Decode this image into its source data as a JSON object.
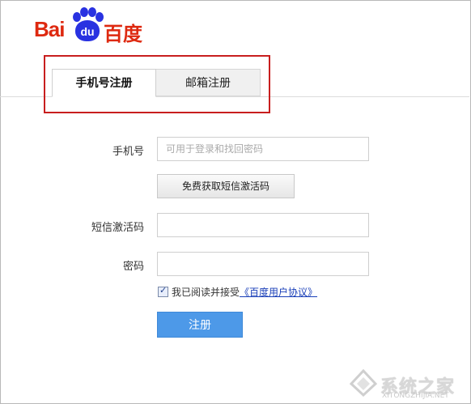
{
  "brand": {
    "logo_latin": "Bai",
    "logo_paw_text": "du",
    "logo_chinese": "百度"
  },
  "tabs": [
    {
      "label": "手机号注册",
      "active": true
    },
    {
      "label": "邮箱注册",
      "active": false
    }
  ],
  "form": {
    "phone_label": "手机号",
    "phone_placeholder": "可用于登录和找回密码",
    "sms_button": "免费获取短信激活码",
    "sms_code_label": "短信激活码",
    "password_label": "密码",
    "agree_text": "我已阅读并接受",
    "agree_link": "《百度用户协议》",
    "agree_checked": true,
    "submit": "注册"
  },
  "watermark": {
    "text": "系统之家",
    "url": "XITONGZHIJIA.NET"
  },
  "colors": {
    "brand_red": "#de2910",
    "brand_blue": "#2932e1",
    "button_blue": "#4d99e8",
    "highlight_red": "#c81e1e"
  }
}
